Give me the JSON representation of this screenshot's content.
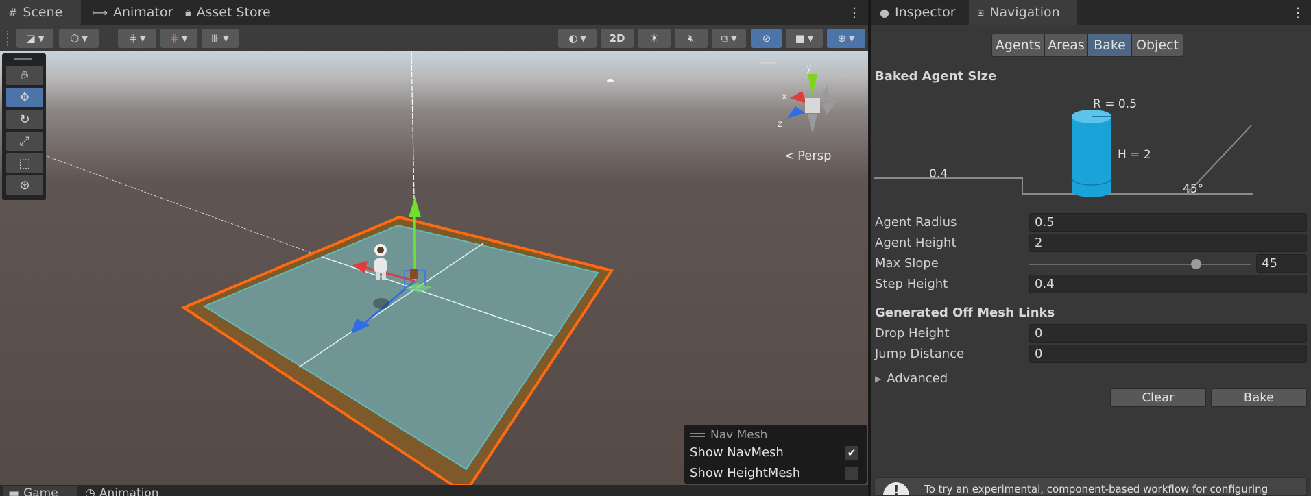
{
  "scene_tabs": {
    "tabs": [
      {
        "label": "Scene",
        "icon": "grid-icon"
      },
      {
        "label": "Animator",
        "icon": "animator-icon"
      },
      {
        "label": "Asset Store",
        "icon": "store-bag-icon"
      }
    ]
  },
  "scene_toolbar": {
    "mode_2d_label": "2D"
  },
  "scene_view": {
    "projection_label": "Persp",
    "gizmo_axes": {
      "x": "x",
      "y": "y",
      "z": "z"
    }
  },
  "navmesh_overlay": {
    "title": "Nav Mesh",
    "show_navmesh_label": "Show NavMesh",
    "show_navmesh_checked": true,
    "show_heightmesh_label": "Show HeightMesh",
    "show_heightmesh_checked": false
  },
  "bottom_tabs": [
    {
      "label": "Game"
    },
    {
      "label": "Animation"
    }
  ],
  "inspector": {
    "tabs": [
      {
        "label": "Inspector",
        "icon": "info-icon"
      },
      {
        "label": "Navigation",
        "icon": "navigation-icon"
      }
    ],
    "nav_sections": [
      "Agents",
      "Areas",
      "Bake",
      "Object"
    ],
    "active_section": "Bake",
    "baked_agent_size": {
      "title": "Baked Agent Size",
      "radius_label": "R = 0.5",
      "height_label": "H = 2",
      "step_label": "0.4",
      "slope_label": "45°"
    },
    "fields": {
      "agent_radius": {
        "label": "Agent Radius",
        "value": "0.5"
      },
      "agent_height": {
        "label": "Agent Height",
        "value": "2"
      },
      "max_slope": {
        "label": "Max Slope",
        "value": "45",
        "slider_fraction": 0.75
      },
      "step_height": {
        "label": "Step Height",
        "value": "0.4"
      }
    },
    "off_mesh": {
      "title": "Generated Off Mesh Links",
      "drop_height": {
        "label": "Drop Height",
        "value": "0"
      },
      "jump_distance": {
        "label": "Jump Distance",
        "value": "0"
      }
    },
    "advanced_label": "Advanced",
    "clear_label": "Clear",
    "bake_label": "Bake",
    "info_text": "To try an experimental, component-based workflow for configuring"
  },
  "colors": {
    "accent": "#4d74a8",
    "navmesh_border": "#ff6a10",
    "agent_cylinder": "#1aa3d8"
  }
}
